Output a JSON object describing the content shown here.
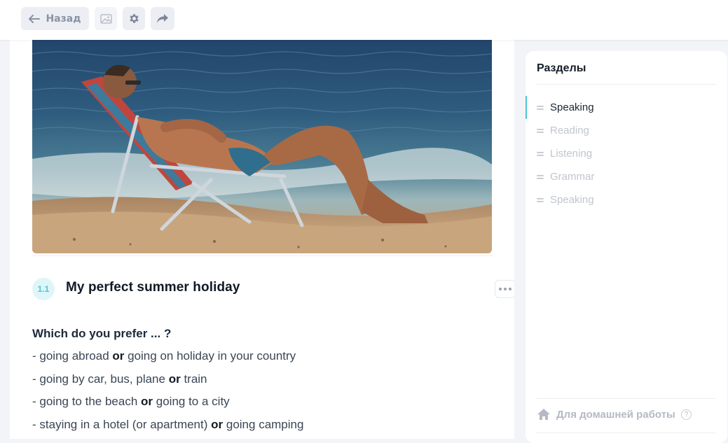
{
  "toolbar": {
    "back_label": "Назад",
    "icons": [
      "arrow-left-icon",
      "image-icon",
      "gear-icon",
      "share-icon"
    ]
  },
  "lesson": {
    "section_number": "1.1",
    "section_title": "My perfect summer holiday",
    "question": "Which do you prefer ... ?",
    "options": [
      {
        "prefix": "- ",
        "a": "going abroad",
        "or": "or",
        "b": "going on holiday in your country"
      },
      {
        "prefix": "- ",
        "a": "going by car, bus, plane",
        "or": "or",
        "b": "train"
      },
      {
        "prefix": "- ",
        "a": "going to the beach",
        "or": "or",
        "b": "going to a city"
      },
      {
        "prefix": "- ",
        "a": "staying in a hotel (or apartment)",
        "or": "or",
        "b": "going camping"
      }
    ]
  },
  "sidebar": {
    "title": "Разделы",
    "items": [
      {
        "label": "Speaking",
        "active": true
      },
      {
        "label": "Reading",
        "active": false
      },
      {
        "label": "Listening",
        "active": false
      },
      {
        "label": "Grammar",
        "active": false
      },
      {
        "label": "Speaking",
        "active": false
      }
    ],
    "homework_label": "Для домашней работы",
    "help_mark": "?"
  },
  "colors": {
    "accent": "#4cc6d2",
    "badge_bg": "#dff6f8",
    "page_bg": "#f3f4f8"
  }
}
